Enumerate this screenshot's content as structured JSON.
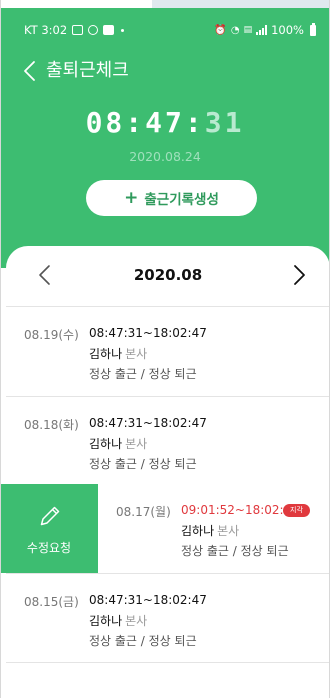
{
  "status_bar": {
    "time": "KT 3:02",
    "icons": [
      "gallery-icon",
      "instagram-icon",
      "e-icon",
      "dot-icon"
    ],
    "right_icons": [
      "alarm-icon",
      "wifi-icon",
      "volte-icon",
      "signal-icon"
    ],
    "battery": "100%"
  },
  "nav": {
    "title": "출퇴근체크",
    "back_icon": "chevron-left-icon"
  },
  "clock": {
    "hm": "08:47:",
    "sec": "31"
  },
  "date": "2020.08.24",
  "create_button": {
    "label": "출근기록생성",
    "icon": "plus-icon"
  },
  "month_nav": {
    "label": "2020.08",
    "prev_icon": "chevron-left-icon",
    "next_icon": "chevron-right-icon"
  },
  "records": [
    {
      "date": "08.19(수)",
      "time": "08:47:31~18:02:47",
      "name": "김하나",
      "dept": "본사",
      "status": "정상 출근 / 정상 퇴근"
    },
    {
      "date": "08.18(화)",
      "time": "08:47:31~18:02:47",
      "name": "김하나",
      "dept": "본사",
      "status": "정상 출근 / 정상 퇴근"
    },
    {
      "date": "08.17(월)",
      "time": "09:01:52~18:02:47",
      "name": "김하나",
      "dept": "본사",
      "status": "정상 출근 / 정상 퇴근",
      "badge": "지각"
    },
    {
      "date": "08.15(금)",
      "time": "08:47:31~18:02:47",
      "name": "김하나",
      "dept": "본사",
      "status": "정상 출근 / 정상 퇴근"
    }
  ],
  "edit_action": {
    "label": "수정요청",
    "icon": "pencil-icon"
  },
  "colors": {
    "primary": "#3dbd71",
    "late": "#e0393e"
  }
}
